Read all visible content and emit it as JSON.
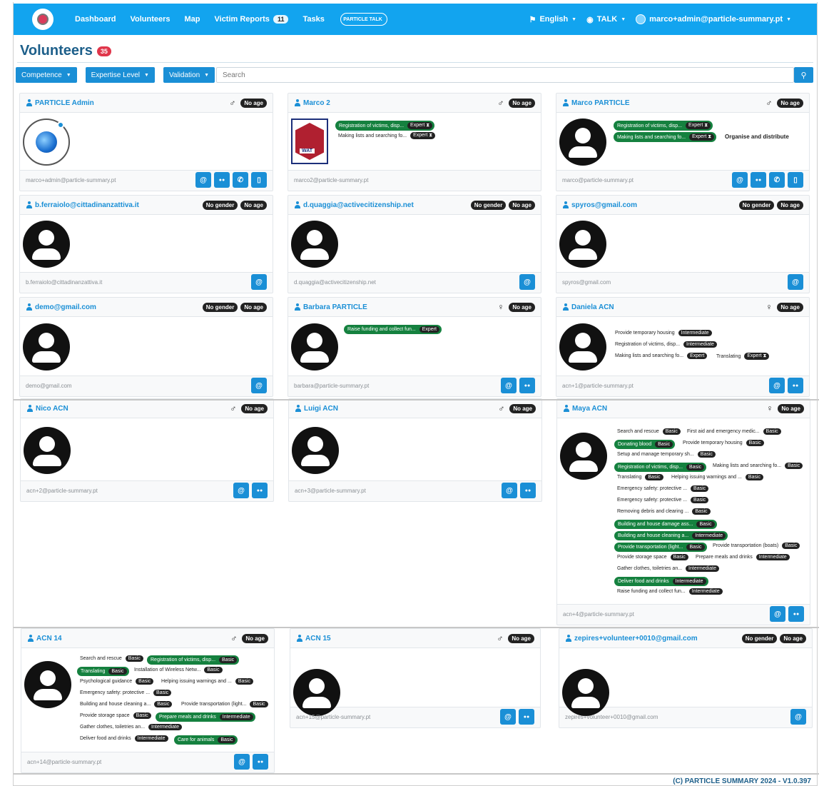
{
  "nav": {
    "dashboard": "Dashboard",
    "volunteers": "Volunteers",
    "map": "Map",
    "victim_reports": "Victim Reports",
    "victim_count": "11",
    "tasks": "Tasks",
    "logo_text": "PARTICLE TALK",
    "language": "English",
    "talk": "TALK",
    "user": "marco+admin@particle-summary.pt"
  },
  "page": {
    "title": "Volunteers",
    "count": "35"
  },
  "filters": {
    "competence": "Competence",
    "expertise": "Expertise Level",
    "validation": "Validation",
    "search_placeholder": "Search"
  },
  "cards": [
    {
      "name": "PARTICLE Admin",
      "gender": "♂",
      "age": "No age",
      "email": "marco+admin@particle-summary.pt"
    },
    {
      "name": "Marco 2",
      "gender": "♂",
      "age": "No age",
      "email": "marco2@particle-summary.pt",
      "logo": "WAT",
      "skills": [
        [
          "Registration of victims, disp...",
          "Expert ⧗"
        ],
        [
          "Making lists and searching fo...",
          "Expert ⧗"
        ]
      ]
    },
    {
      "name": "Marco PARTICLE",
      "gender": "♂",
      "age": "No age",
      "email": "marco@particle-summary.pt",
      "skills": [
        [
          "Registration of victims, disp...",
          "Expert ⧗"
        ],
        [
          "Making lists and searching fo...",
          "Expert ⧗"
        ]
      ],
      "extra": "Organise and distribute"
    },
    {
      "name": "b.ferraiolo@cittadinanzattiva.it",
      "gender": "No gender",
      "age": "No age",
      "email": "b.ferraiolo@cittadinanzattiva.it"
    },
    {
      "name": "d.quaggia@activecitizenship.net",
      "gender": "No gender",
      "age": "No age",
      "email": "d.quaggia@activecitizenship.net"
    },
    {
      "name": "spyros@gmail.com",
      "gender": "No gender",
      "age": "No age",
      "email": "spyros@gmail.com"
    },
    {
      "name": "demo@gmail.com",
      "gender": "No gender",
      "age": "No age",
      "email": "demo@gmail.com"
    },
    {
      "name": "Barbara PARTICLE",
      "gender": "♀",
      "age": "No age",
      "email": "barbara@particle-summary.pt",
      "skills": [
        [
          "Raise funding and collect fun...",
          "Expert"
        ]
      ]
    },
    {
      "name": "Daniela ACN",
      "gender": "♀",
      "age": "No age",
      "email": "acn+1@particle-summary.pt",
      "skills": [
        [
          "Provide temporary housing",
          "Intermediate"
        ],
        [
          "Registration of victims, disp...",
          "Intermediate"
        ],
        [
          "Making lists and searching fo...",
          "Expert"
        ],
        [
          "Translating",
          "Expert ⧗"
        ]
      ]
    },
    {
      "name": "Nico ACN",
      "gender": "♂",
      "age": "No age",
      "email": "acn+2@particle-summary.pt"
    },
    {
      "name": "Luigi ACN",
      "gender": "♂",
      "age": "No age",
      "email": "acn+3@particle-summary.pt"
    },
    {
      "name": "Maya ACN",
      "gender": "♀",
      "age": "No age",
      "email": "acn+4@particle-summary.pt",
      "skills": [
        [
          "Search and rescue",
          "Basic"
        ],
        [
          "First aid and emergency medic...",
          "Basic"
        ],
        [
          "Donating blood",
          "Basic"
        ],
        [
          "Provide temporary housing",
          "Basic"
        ],
        [
          "Setup and manage temporary sh...",
          "Basic"
        ],
        [
          "Registration of victims, disp...",
          "Basic"
        ],
        [
          "Making lists and searching fo...",
          "Basic"
        ],
        [
          "Translating",
          "Basic"
        ],
        [
          "Helping issuing warnings and ...",
          "Basic"
        ],
        [
          "Emergency safety: protective ...",
          "Basic"
        ],
        [
          "Emergency safety: protective ...",
          "Basic"
        ],
        [
          "Removing debris and clearing ...",
          "Basic"
        ],
        [
          "Building and house damage ass...",
          "Basic"
        ],
        [
          "Building and house cleaning a...",
          "Intermediate"
        ],
        [
          "Provide transportation (light...",
          "Basic"
        ],
        [
          "Provide transportation (boats)",
          "Basic"
        ],
        [
          "Provide storage space",
          "Basic"
        ],
        [
          "Prepare meals and drinks",
          "Intermediate"
        ],
        [
          "Gather clothes, toiletries an...",
          "Intermediate"
        ],
        [
          "Deliver food and drinks",
          "Intermediate"
        ],
        [
          "Raise funding and collect fun...",
          "Intermediate"
        ]
      ]
    },
    {
      "name": "ACN 14",
      "gender": "♂",
      "age": "No age",
      "email": "acn+14@particle-summary.pt",
      "skills": [
        [
          "Search and rescue",
          "Basic"
        ],
        [
          "Registration of victims, disp...",
          "Basic"
        ],
        [
          "Translating",
          "Basic"
        ],
        [
          "Installation of Wireless Netw...",
          "Basic"
        ],
        [
          "Psychological guidance",
          "Basic"
        ],
        [
          "Helping issuing warnings and ...",
          "Basic"
        ],
        [
          "Emergency safety: protective ...",
          "Basic"
        ],
        [
          "Building and house cleaning a...",
          "Basic"
        ],
        [
          "Provide transportation (light...",
          "Basic"
        ],
        [
          "Provide storage space",
          "Basic"
        ],
        [
          "Prepare meals and drinks",
          "Intermediate"
        ],
        [
          "Gather clothes, toiletries an...",
          "Intermediate"
        ],
        [
          "Deliver food and drinks",
          "Intermediate"
        ],
        [
          "Care for animals",
          "Basic"
        ]
      ]
    },
    {
      "name": "ACN 15",
      "gender": "♂",
      "age": "No age",
      "email": "acn+15@particle-summary.pt"
    },
    {
      "name": "zepires+volunteer+0010@gmail.com",
      "gender": "No gender",
      "age": "No age",
      "email": "zepires+volunteer+0010@gmail.com"
    }
  ],
  "footer": "(C) PARTICLE SUMMARY 2024 - V1.0.397"
}
